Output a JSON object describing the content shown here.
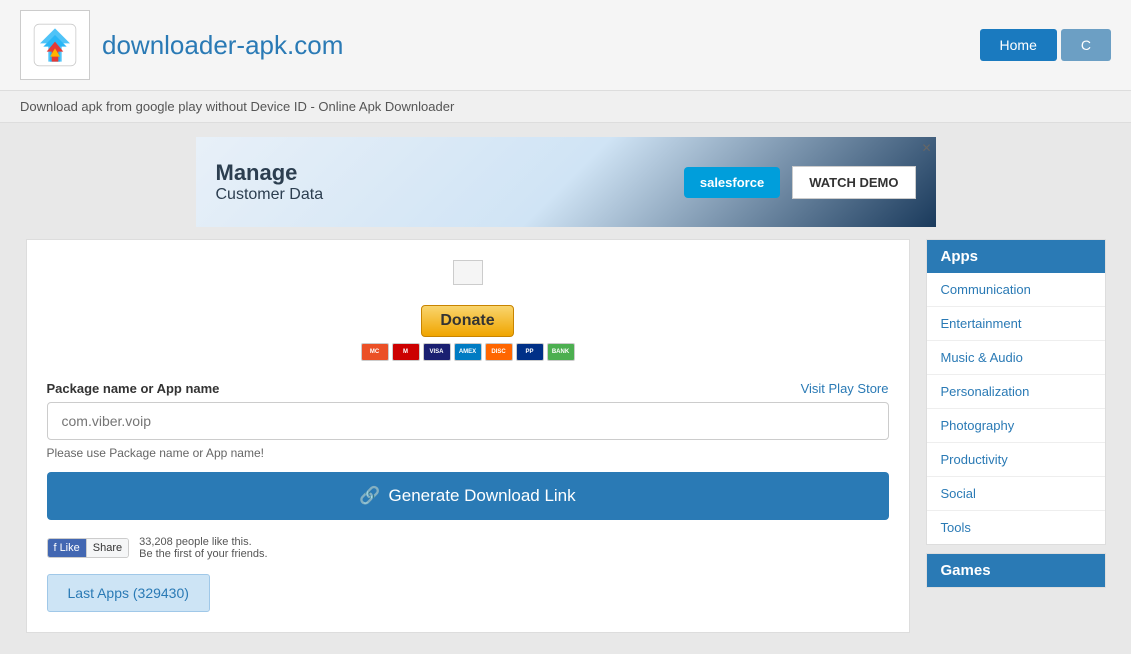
{
  "header": {
    "logo_text": "downloader-apk.com",
    "home_label": "Home",
    "second_btn_label": "C"
  },
  "subtitle": "Download apk from google play without Device ID - Online Apk Downloader",
  "ad": {
    "line1": "Manage",
    "line2": "Customer Data",
    "salesforce_label": "salesforce",
    "watch_demo_label": "WATCH DEMO",
    "close_label": "✕"
  },
  "donate": {
    "button_label": "Donate"
  },
  "form": {
    "package_label": "Package name or App name",
    "visit_store_label": "Visit Play Store",
    "placeholder": "com.viber.voip",
    "hint": "Please use Package name or App name!",
    "generate_label": "Generate Download Link",
    "link_icon": "🔗"
  },
  "facebook": {
    "like_label": "Like",
    "share_label": "Share",
    "count_text": "33,208 people like this.",
    "count_sub": "Be the first of your friends."
  },
  "last_apps": {
    "button_label": "Last Apps (329430)"
  },
  "sidebar": {
    "apps_header": "Apps",
    "apps_items": [
      "Communication",
      "Entertainment",
      "Music & Audio",
      "Personalization",
      "Photography",
      "Productivity",
      "Social",
      "Tools"
    ],
    "games_header": "Games"
  },
  "payment_icons": [
    "MC",
    "VISA",
    "AMEX",
    "DISC",
    "PP",
    "BANK"
  ]
}
